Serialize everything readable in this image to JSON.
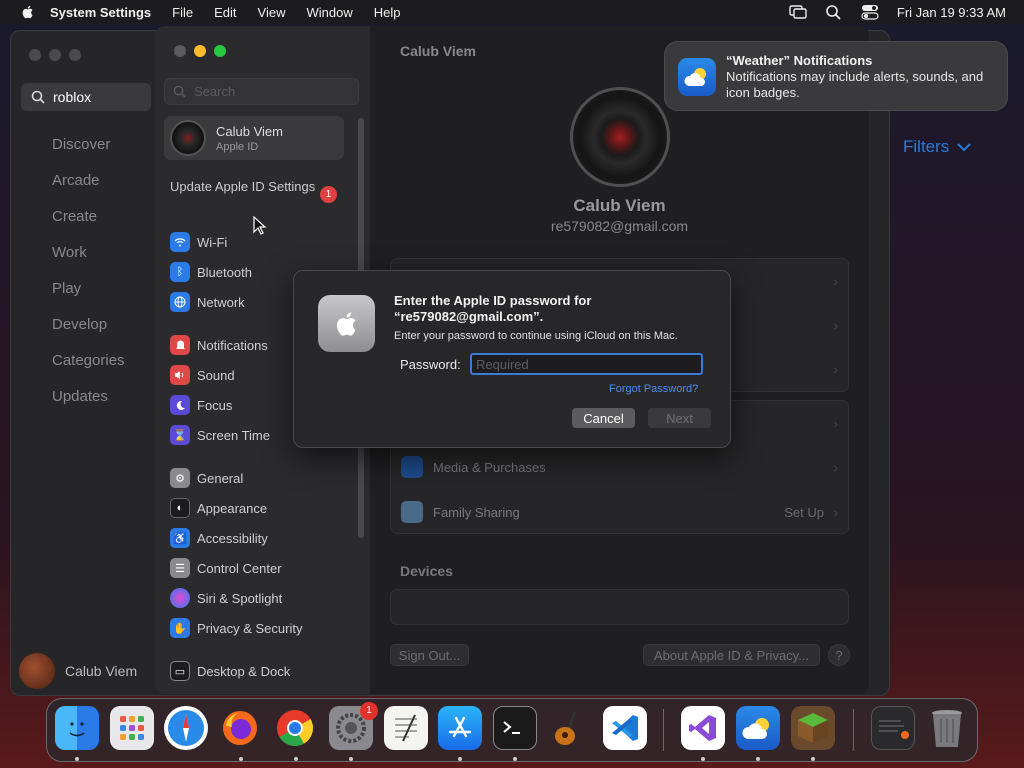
{
  "menubar": {
    "app_name": "System Settings",
    "items": [
      "File",
      "Edit",
      "View",
      "Window",
      "Help"
    ],
    "clock": "Fri Jan 19  9:33 AM"
  },
  "appstore": {
    "search_value": "roblox",
    "nav": [
      "Discover",
      "Arcade",
      "Create",
      "Work",
      "Play",
      "Develop",
      "Categories",
      "Updates"
    ],
    "user_name": "Calub Viem",
    "filters_label": "Filters"
  },
  "sidebar": {
    "search_placeholder": "Search",
    "account": {
      "name": "Calub Viem",
      "sub": "Apple ID"
    },
    "update_label": "Update Apple ID Settings",
    "update_badge": "1",
    "items": [
      {
        "label": "Wi-Fi",
        "color": "#2a7ae8"
      },
      {
        "label": "Bluetooth",
        "color": "#2a7ae8"
      },
      {
        "label": "Network",
        "color": "#2a7ae8"
      },
      {
        "label": "Notifications",
        "color": "#e04848"
      },
      {
        "label": "Sound",
        "color": "#e04848"
      },
      {
        "label": "Focus",
        "color": "#5a4ad8"
      },
      {
        "label": "Screen Time",
        "color": "#5a4ad8"
      },
      {
        "label": "General",
        "color": "#8a8a8e"
      },
      {
        "label": "Appearance",
        "color": "#1c1c1e"
      },
      {
        "label": "Accessibility",
        "color": "#2a7ae8"
      },
      {
        "label": "Control Center",
        "color": "#8a8a8e"
      },
      {
        "label": "Siri & Spotlight",
        "color": "#c04ad8"
      },
      {
        "label": "Privacy & Security",
        "color": "#2a7ae8"
      },
      {
        "label": "Desktop & Dock",
        "color": "#1c1c1e"
      }
    ]
  },
  "main": {
    "title": "Calub Viem",
    "name": "Calub Viem",
    "email": "re579082@gmail.com",
    "media_label": "Media & Purchases",
    "family_label": "Family Sharing",
    "family_value": "Set Up",
    "devices_heading": "Devices",
    "sign_out": "Sign Out...",
    "about": "About Apple ID & Privacy...",
    "help": "?"
  },
  "dialog": {
    "title": "Enter the Apple ID password for “re579082@gmail.com”.",
    "subtitle": "Enter your password to continue using iCloud on this Mac.",
    "password_label": "Password:",
    "password_placeholder": "Required",
    "forgot": "Forgot Password?",
    "cancel": "Cancel",
    "next": "Next"
  },
  "notification": {
    "title": "“Weather” Notifications",
    "body": "Notifications may include alerts, sounds, and icon badges."
  },
  "dock": {
    "settings_badge": "1",
    "apps": [
      "finder-icon",
      "launchpad-icon",
      "safari-icon",
      "firefox-icon",
      "chrome-icon",
      "system-settings-icon",
      "textedit-icon",
      "app-store-icon",
      "terminal-icon",
      "garageband-icon",
      "vscode-icon",
      "visual-studio-icon",
      "weather-icon",
      "minecraft-icon",
      "screenshot-icon",
      "trash-icon"
    ]
  }
}
